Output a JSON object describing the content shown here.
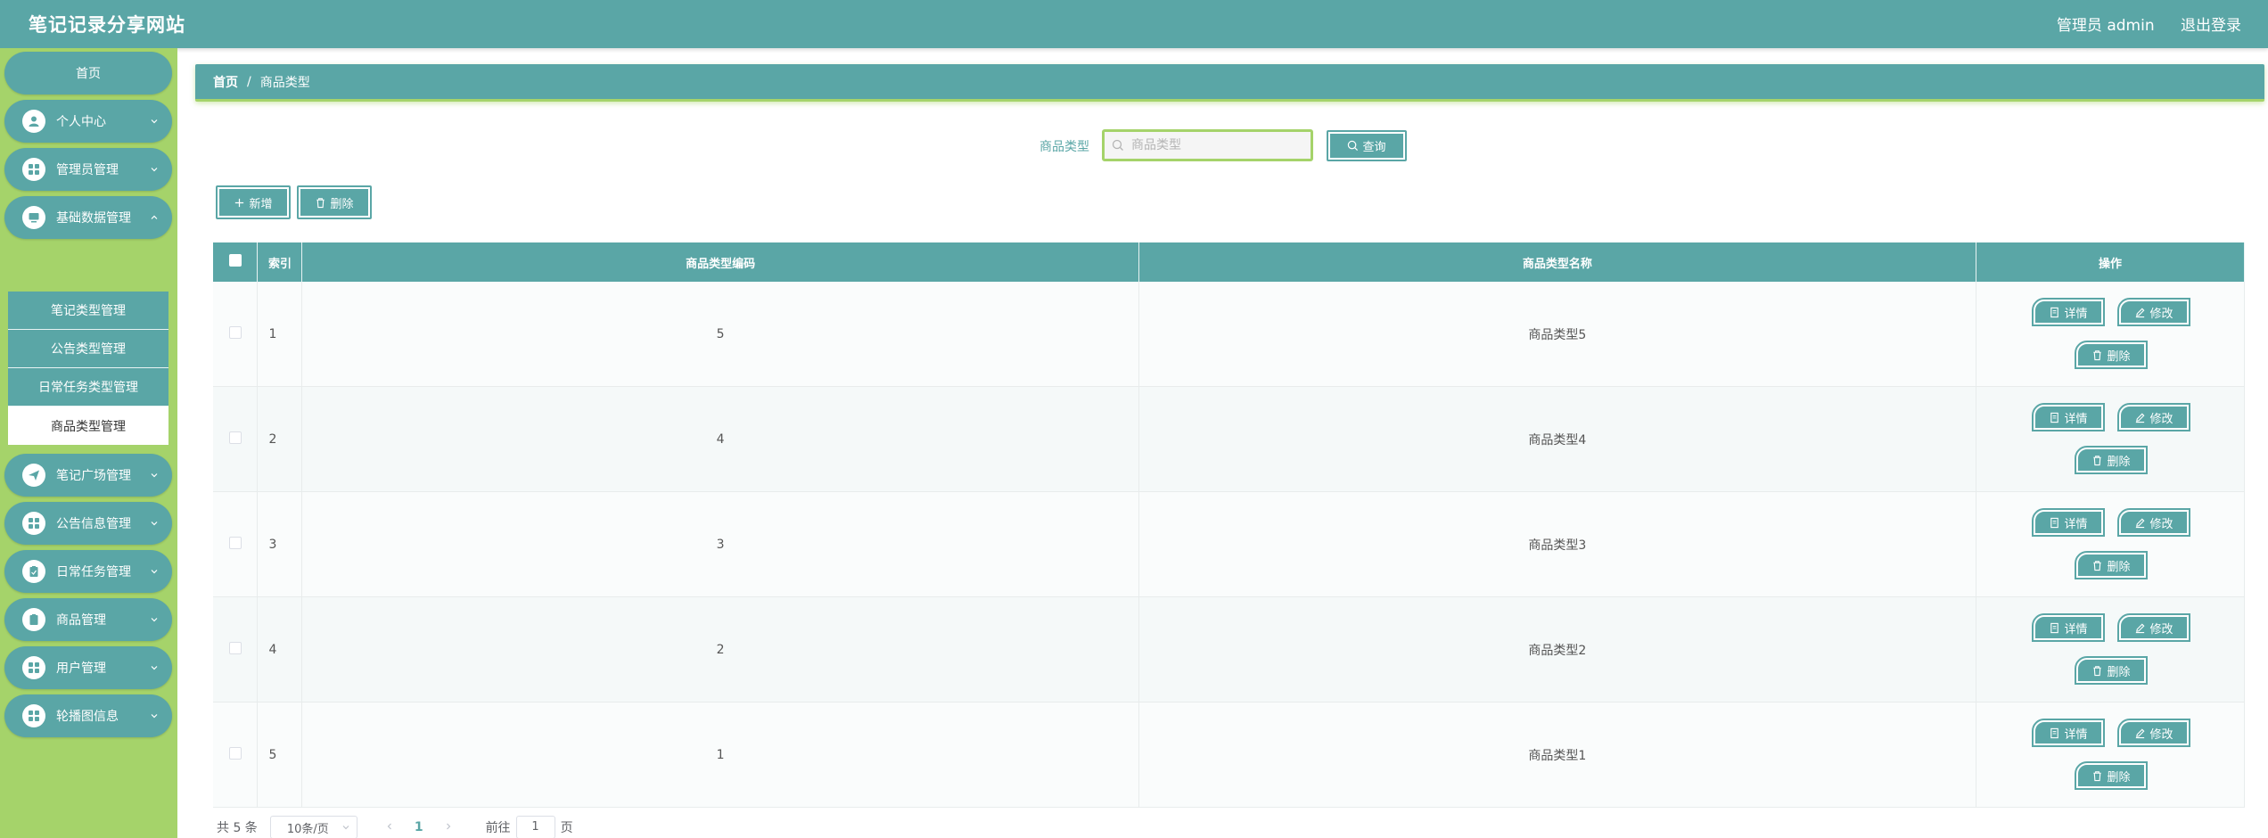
{
  "header": {
    "site_title": "笔记记录分享网站",
    "user_label": "管理员 admin",
    "logout_label": "退出登录"
  },
  "sidebar": {
    "home": "首页",
    "items": [
      {
        "label": "个人中心",
        "icon": "user-icon"
      },
      {
        "label": "管理员管理",
        "icon": "grid-icon"
      },
      {
        "label": "基础数据管理",
        "icon": "monitor-icon"
      },
      {
        "label": "笔记广场管理",
        "icon": "send-icon"
      },
      {
        "label": "公告信息管理",
        "icon": "grid-icon"
      },
      {
        "label": "日常任务管理",
        "icon": "clipboard-icon"
      },
      {
        "label": "商品管理",
        "icon": "clipboard-icon"
      },
      {
        "label": "用户管理",
        "icon": "grid-icon"
      },
      {
        "label": "轮播图信息",
        "icon": "grid-icon"
      }
    ],
    "submenu": [
      "笔记类型管理",
      "公告类型管理",
      "日常任务类型管理",
      "商品类型管理"
    ]
  },
  "breadcrumb": {
    "home": "首页",
    "separator": "/",
    "current": "商品类型"
  },
  "search": {
    "label": "商品类型",
    "placeholder": "商品类型",
    "value": "",
    "query_button": "查询"
  },
  "toolbar": {
    "add_label": "新增",
    "delete_label": "删除"
  },
  "table": {
    "headers": [
      "",
      "索引",
      "商品类型编码",
      "商品类型名称",
      "操作"
    ],
    "rows": [
      {
        "index": "1",
        "code": "5",
        "name": "商品类型5"
      },
      {
        "index": "2",
        "code": "4",
        "name": "商品类型4"
      },
      {
        "index": "3",
        "code": "3",
        "name": "商品类型3"
      },
      {
        "index": "4",
        "code": "2",
        "name": "商品类型2"
      },
      {
        "index": "5",
        "code": "1",
        "name": "商品类型1"
      }
    ],
    "actions": {
      "detail": "详情",
      "edit": "修改",
      "delete": "删除"
    }
  },
  "pagination": {
    "total": "共 5 条",
    "page_size": "10条/页",
    "current_page": "1",
    "goto_label": "前往",
    "goto_value": "1",
    "page_suffix": "页"
  },
  "colors": {
    "primary": "#5aa6a6",
    "accent": "#a5d36a"
  }
}
